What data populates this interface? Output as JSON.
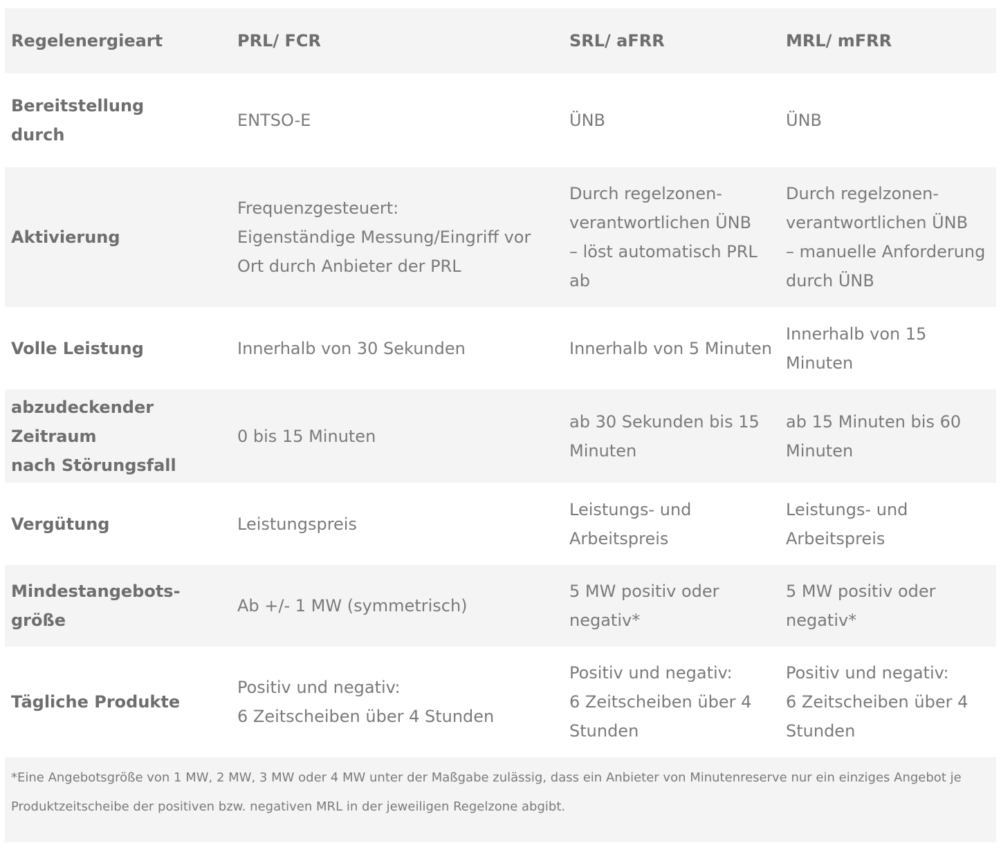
{
  "header": {
    "col1": "Regelenergieart",
    "col2": "PRL/ FCR",
    "col3": "SRL/ aFRR",
    "col4": "MRL/ mFRR"
  },
  "rows": [
    {
      "label": "Bereitstellung\ndurch",
      "prl": "ENTSO-E",
      "srl": "ÜNB",
      "mrl": "ÜNB"
    },
    {
      "label": "Aktivierung",
      "prl": "Frequenzgesteuert:\nEigenständige Messung/Eingriff vor\nOrt durch Anbieter der PRL",
      "srl": "Durch regelzonen-\nverantwortlichen ÜNB\n– löst automatisch PRL\nab",
      "mrl": "Durch regelzonen-\nverantwortlichen ÜNB\n– manuelle Anforderung\ndurch ÜNB"
    },
    {
      "label": "Volle Leistung",
      "prl": "Innerhalb von 30 Sekunden",
      "srl": "Innerhalb von 5 Minuten",
      "mrl": "Innerhalb von 15\nMinuten"
    },
    {
      "label": "abzudeckender Zeitraum\nnach Störungsfall",
      "prl": "0 bis 15 Minuten",
      "srl": "ab 30 Sekunden bis 15\nMinuten",
      "mrl": "ab 15 Minuten bis 60\nMinuten"
    },
    {
      "label": "Vergütung",
      "prl": "Leistungspreis",
      "srl": "Leistungs- und\nArbeitspreis",
      "mrl": "Leistungs- und\nArbeitspreis"
    },
    {
      "label": "Mindestangebots-größe",
      "prl": "Ab +/- 1 MW (symmetrisch)",
      "srl": "5 MW positiv oder\nnegativ*",
      "mrl": "5 MW positiv oder\nnegativ*"
    },
    {
      "label": "Tägliche Produkte",
      "prl": "Positiv und negativ:\n6 Zeitscheiben über 4 Stunden",
      "srl": "Positiv und negativ:\n6 Zeitscheiben über 4\nStunden",
      "mrl": "Positiv und negativ:\n6 Zeitscheiben über 4\nStunden"
    }
  ],
  "footnote": "*Eine Angebotsgröße von 1 MW, 2 MW, 3 MW oder 4 MW unter der Maßgabe zulässig, dass ein Anbieter von Minutenreserve nur ein einziges Angebot je Produktzeitscheibe der positiven bzw. negativen MRL in der jeweiligen Regelzone abgibt."
}
